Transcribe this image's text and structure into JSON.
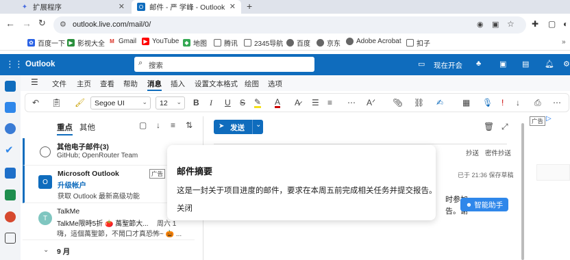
{
  "tabs": [
    {
      "title": "扩展程序",
      "icon": "puzzle-icon",
      "active": false
    },
    {
      "title": "邮件 - 严 学峰 - Outlook",
      "icon": "outlook-icon",
      "active": true
    }
  ],
  "address": {
    "url": "outlook.live.com/mail/0/"
  },
  "bookmarks": [
    {
      "label": "百度一下",
      "color": "#2a62e5"
    },
    {
      "label": "影视大全",
      "color": "#2a8f3c"
    },
    {
      "label": "Gmail",
      "color": "#d93025"
    },
    {
      "label": "YouTube",
      "color": "#ff0000"
    },
    {
      "label": "地图",
      "color": "#34a853"
    },
    {
      "label": "腾讯",
      "color": "#555555"
    },
    {
      "label": "2345导航",
      "color": "#555555"
    },
    {
      "label": "百度",
      "color": "#2a62e5"
    },
    {
      "label": "京东",
      "color": "#555555"
    },
    {
      "label": "Adobe Acrobat",
      "color": "#555555"
    },
    {
      "label": "扣子",
      "color": "#555555"
    }
  ],
  "outlook": {
    "app_name": "Outlook",
    "search_placeholder": "搜索",
    "meet_now": "现在开会",
    "brand_color": "#0f6cbd"
  },
  "menu": [
    "文件",
    "主页",
    "查看",
    "帮助",
    "消息",
    "插入",
    "设置文本格式",
    "绘图",
    "选项"
  ],
  "menu_active": "消息",
  "ribbon": {
    "font": "Segoe UI",
    "size": "12"
  },
  "list": {
    "tab_focused": "重点",
    "tab_other": "其他",
    "items": [
      {
        "sender": "其他电子邮件(3)",
        "preview": "GitHub; OpenRouter Team"
      },
      {
        "sender": "Microsoft Outlook",
        "badge": "广告",
        "subject": "升级帐户",
        "preview": "获取 Outlook 最新高级功能"
      },
      {
        "sender": "TalkMe",
        "avatar": "T",
        "subject": "TalkMe限時5折 🍅 萬聖節大...",
        "date": "周六 1",
        "preview": "嗨，這個萬聖節，不鬧口才真恐怖~ 🎃 ..."
      }
    ],
    "group_label": "9 月"
  },
  "compose": {
    "send_label": "发送",
    "cc_label": "抄送",
    "bcc_label": "密件抄送",
    "saved_text": "已于 21:36 保存草稿",
    "body_fragment_1": "时参加。",
    "body_fragment_2": "告。谢"
  },
  "ad": {
    "badge": "广告"
  },
  "popup": {
    "title": "邮件摘要",
    "body": "这是一封关于项目进度的邮件，要求在本周五前完成相关任务并提交报告。",
    "close_label": "关闭"
  },
  "assistant": {
    "label": "智能助手"
  }
}
